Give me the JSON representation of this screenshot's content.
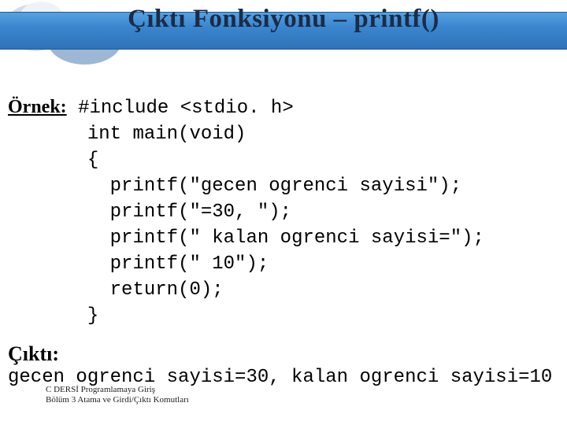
{
  "header": {
    "title": "Çıktı Fonksiyonu – printf()"
  },
  "example": {
    "label": "Örnek:",
    "code_lines": [
      "#include <stdio. h>",
      "int main(void)",
      "{",
      "  printf(\"gecen ogrenci sayisi\");",
      "  printf(\"=30, \");",
      "  printf(\" kalan ogrenci sayisi=\");",
      "  printf(\" 10\");",
      "  return(0);",
      "}"
    ]
  },
  "output": {
    "label": "Çıktı:",
    "text": "gecen ogrenci sayisi=30, kalan ogrenci sayisi=10"
  },
  "footer": {
    "line1": "C DERSİ Programlamaya Giriş",
    "line2": "Bölüm 3  Atama ve Girdi/Çıktı Komutları"
  }
}
